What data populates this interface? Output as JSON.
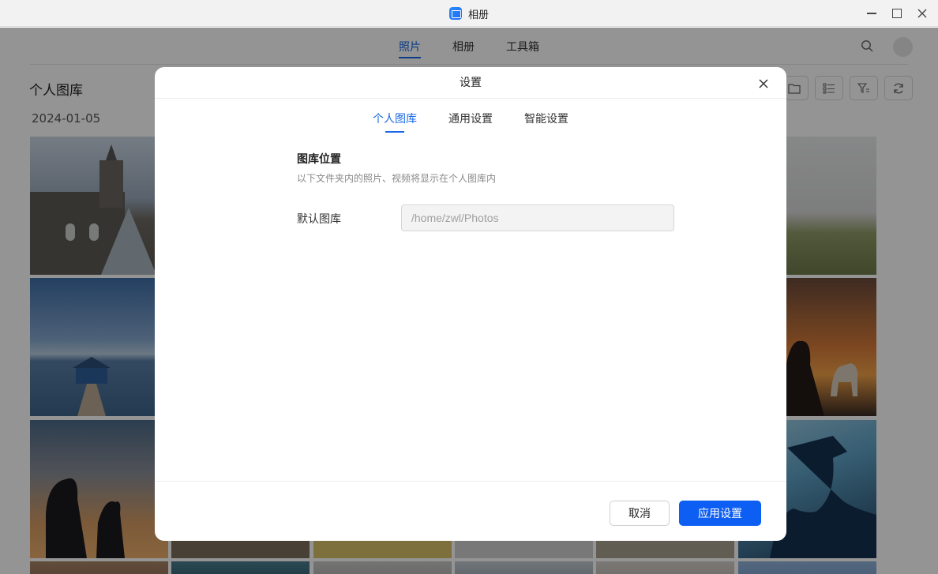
{
  "window": {
    "title": "相册",
    "app_icon": "photos-app-icon",
    "controls": [
      "minimize-icon",
      "maximize-icon",
      "close-icon"
    ]
  },
  "nav": {
    "tabs": [
      {
        "label": "照片",
        "active": true
      },
      {
        "label": "相册",
        "active": false
      },
      {
        "label": "工具箱",
        "active": false
      }
    ],
    "accent_color": "#1767e6"
  },
  "library": {
    "title": "个人图库",
    "date": "2024-01-05",
    "toolbar_icons": [
      "folder-icon",
      "list-view-icon",
      "filter-icon",
      "refresh-icon"
    ]
  },
  "dialog": {
    "title": "设置",
    "tabs": [
      {
        "label": "个人图库",
        "active": true
      },
      {
        "label": "通用设置",
        "active": false
      },
      {
        "label": "智能设置",
        "active": false
      }
    ],
    "section_title": "图库位置",
    "section_desc": "以下文件夹内的照片、视频将显示在个人图库内",
    "field_label": "默认图库",
    "field_value": "/home/zwl/Photos",
    "cancel_label": "取消",
    "apply_label": "应用设置",
    "apply_color": "#0d5ef3"
  }
}
